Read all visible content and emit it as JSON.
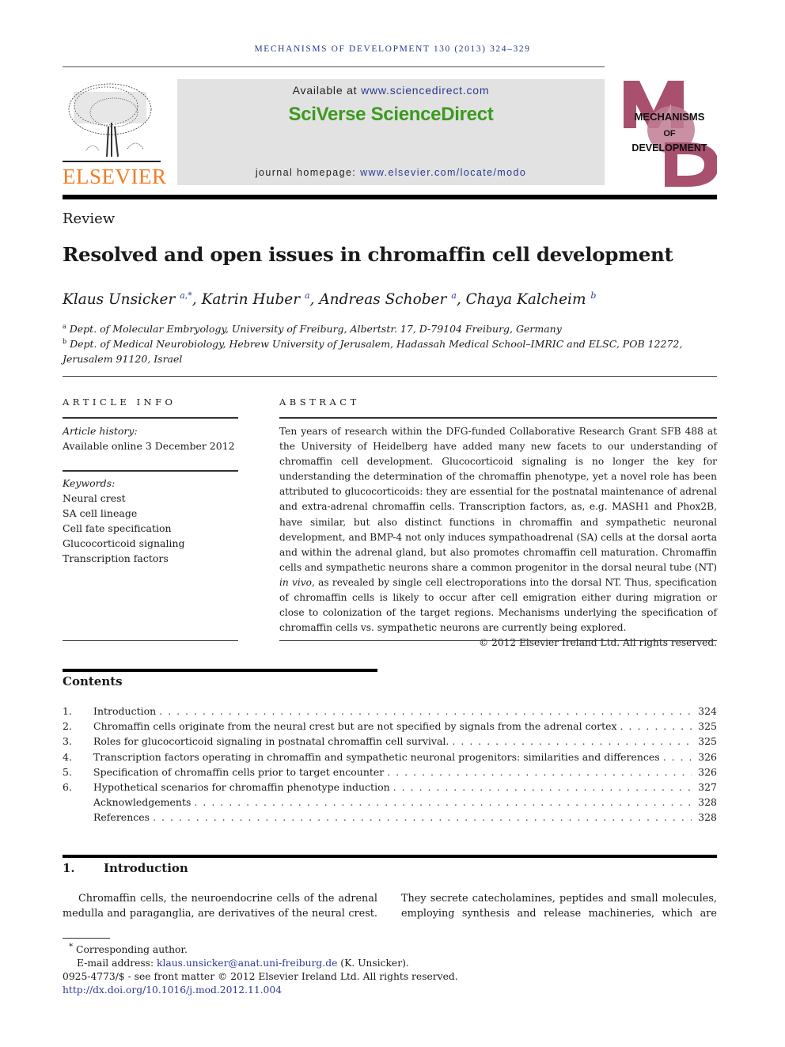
{
  "header": {
    "running_head": "MECHANISMS OF DEVELOPMENT 130 (2013) 324–329",
    "publisher_logo_text": "ELSEVIER",
    "available_at_prefix": "Available at ",
    "available_at_url": "www.sciencedirect.com",
    "platform_name": "SciVerse ScienceDirect",
    "homepage_prefix": "journal homepage: ",
    "homepage_url": "www.elsevier.com/locate/modo",
    "journal_logo": {
      "letters": [
        "M",
        "O",
        "D"
      ],
      "line1": "MECHANISMS",
      "line2": "OF",
      "line3": "DEVELOPMENT",
      "color": "#a8506e"
    },
    "colors": {
      "link_blue": "#2b3990",
      "sciverse_green": "#3c9a1e",
      "elsevier_orange": "#f47b20"
    }
  },
  "article": {
    "type": "Review",
    "title": "Resolved and open issues in chromaffin cell development",
    "authors": [
      {
        "name": "Klaus Unsicker",
        "sup": "a,*",
        "sep": ", "
      },
      {
        "name": "Katrin Huber",
        "sup": "a",
        "sep": ", "
      },
      {
        "name": "Andreas Schober",
        "sup": "a",
        "sep": ", "
      },
      {
        "name": "Chaya Kalcheim",
        "sup": "b",
        "sep": ""
      }
    ],
    "affiliations": [
      {
        "mark": "a",
        "text": "Dept. of Molecular Embryology, University of Freiburg, Albertstr. 17, D-79104 Freiburg, Germany"
      },
      {
        "mark": "b",
        "text": "Dept. of Medical Neurobiology, Hebrew University of Jerusalem, Hadassah Medical School–IMRIC and ELSC, POB 12272, Jerusalem 91120, Israel"
      }
    ]
  },
  "article_info": {
    "heading": "ARTICLE INFO",
    "history_label": "Article history:",
    "history_value": "Available online 3 December 2012",
    "keywords_label": "Keywords:",
    "keywords": [
      "Neural crest",
      "SA cell lineage",
      "Cell fate specification",
      "Glucocorticoid signaling",
      "Transcription factors"
    ]
  },
  "abstract": {
    "heading": "ABSTRACT",
    "text_before_italic": "Ten years of research within the DFG-funded Collaborative Research Grant SFB 488 at the University of Heidelberg have added many new facets to our understanding of chromaffin cell development. Glucocorticoid signaling is no longer the key for understanding the determination of the chromaffin phenotype, yet a novel role has been attributed to glucocorticoids: they are essential for the postnatal maintenance of adrenal and extra-adrenal chromaffin cells. Transcription factors, as, e.g. MASH1 and Phox2B, have similar, but also distinct functions in chromaffin and sympathetic neuronal development, and BMP-4 not only induces sympathoadrenal (SA) cells at the dorsal aorta and within the adrenal gland, but also promotes chromaffin cell maturation. Chromaffin cells and sympathetic neurons share a common progenitor in the dorsal neural tube (NT) ",
    "italic": "in vivo",
    "text_after_italic": ", as revealed by single cell electroporations into the dorsal NT. Thus, specification of chromaffin cells is likely to occur after cell emigration either during migration or close to colonization of the target regions. Mechanisms underlying the specification of chromaffin cells vs. sympathetic neurons are currently being explored.",
    "copyright": "© 2012 Elsevier Ireland Ltd. All rights reserved."
  },
  "contents": {
    "heading": "Contents",
    "items": [
      {
        "num": "1.",
        "label": "Introduction",
        "page": "324"
      },
      {
        "num": "2.",
        "label": "Chromaffin cells originate from the neural crest but are not specified by signals from the adrenal cortex",
        "page": "325"
      },
      {
        "num": "3.",
        "label": "Roles for glucocorticoid signaling in postnatal chromaffin cell survival.",
        "page": "325"
      },
      {
        "num": "4.",
        "label": "Transcription factors operating in chromaffin and sympathetic neuronal progenitors: similarities and differences",
        "page": "326"
      },
      {
        "num": "5.",
        "label": "Specification of chromaffin cells prior to target encounter",
        "page": "326"
      },
      {
        "num": "6.",
        "label": "Hypothetical scenarios for chromaffin phenotype induction",
        "page": "327"
      },
      {
        "num": "",
        "label": "Acknowledgements",
        "page": "328"
      },
      {
        "num": "",
        "label": "References",
        "page": "328"
      }
    ]
  },
  "introduction": {
    "number": "1.",
    "heading": "Introduction",
    "left_col": [
      "Chromaffin cells, the neuroendocrine cells of the adrenal",
      "medulla and paraganglia, are derivatives of the neural crest."
    ],
    "right_col": [
      "They secrete catecholamines, peptides and small molecules,",
      "employing synthesis and release machineries, which are"
    ]
  },
  "footnotes": {
    "corresponding_mark": "*",
    "corresponding": "Corresponding author.",
    "email_label": "E-mail address: ",
    "email": "klaus.unsicker@anat.uni-freiburg.de",
    "email_suffix": " (K. Unsicker).",
    "issn_line": "0925-4773/$ - see front matter © 2012 Elsevier Ireland Ltd. All rights reserved.",
    "doi": "http://dx.doi.org/10.1016/j.mod.2012.11.004"
  }
}
